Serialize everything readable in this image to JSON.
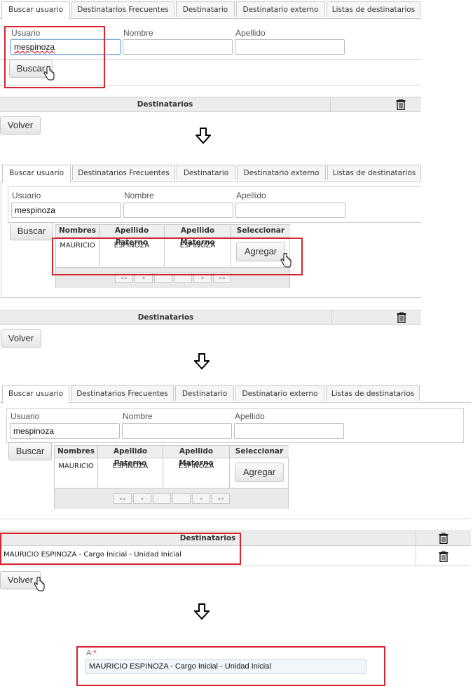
{
  "tabs": [
    "Buscar usuario",
    "Destinatarios Frecuentes",
    "Destinatario",
    "Destinatario externo",
    "Listas de destinatarios"
  ],
  "form": {
    "usuario_label": "Usuario",
    "nombre_label": "Nombre",
    "apellido_label": "Apellido",
    "usuario_value": "mespinoza",
    "buscar_label": "Buscar"
  },
  "results": {
    "headers": [
      "Nombres",
      "Apellido Paterno",
      "Apellido Materno",
      "Seleccionar"
    ],
    "row": {
      "nombres": "MAURICIO",
      "apellido_paterno": "ESPINOZA",
      "apellido_materno": "ESPINOZA",
      "action": "Agregar"
    },
    "pager": [
      "««",
      "«",
      "",
      "",
      "»",
      "»»"
    ]
  },
  "destinatarios": {
    "header": "Destinatarios",
    "entry": "MAURICIO ESPINOZA - Cargo Inicial - Unidad Inicial"
  },
  "volver_label": "Volver",
  "final_field": {
    "label": "A:",
    "required_mark": "*",
    "label_suffix": ".",
    "value": "MAURICIO ESPINOZA - Cargo Inicial - Unidad Inicial"
  },
  "colors": {
    "highlight": "#d9232d",
    "header_bg": "#ececec"
  },
  "icons": [
    "trash-icon",
    "down-arrow-icon",
    "hand-cursor-icon"
  ]
}
